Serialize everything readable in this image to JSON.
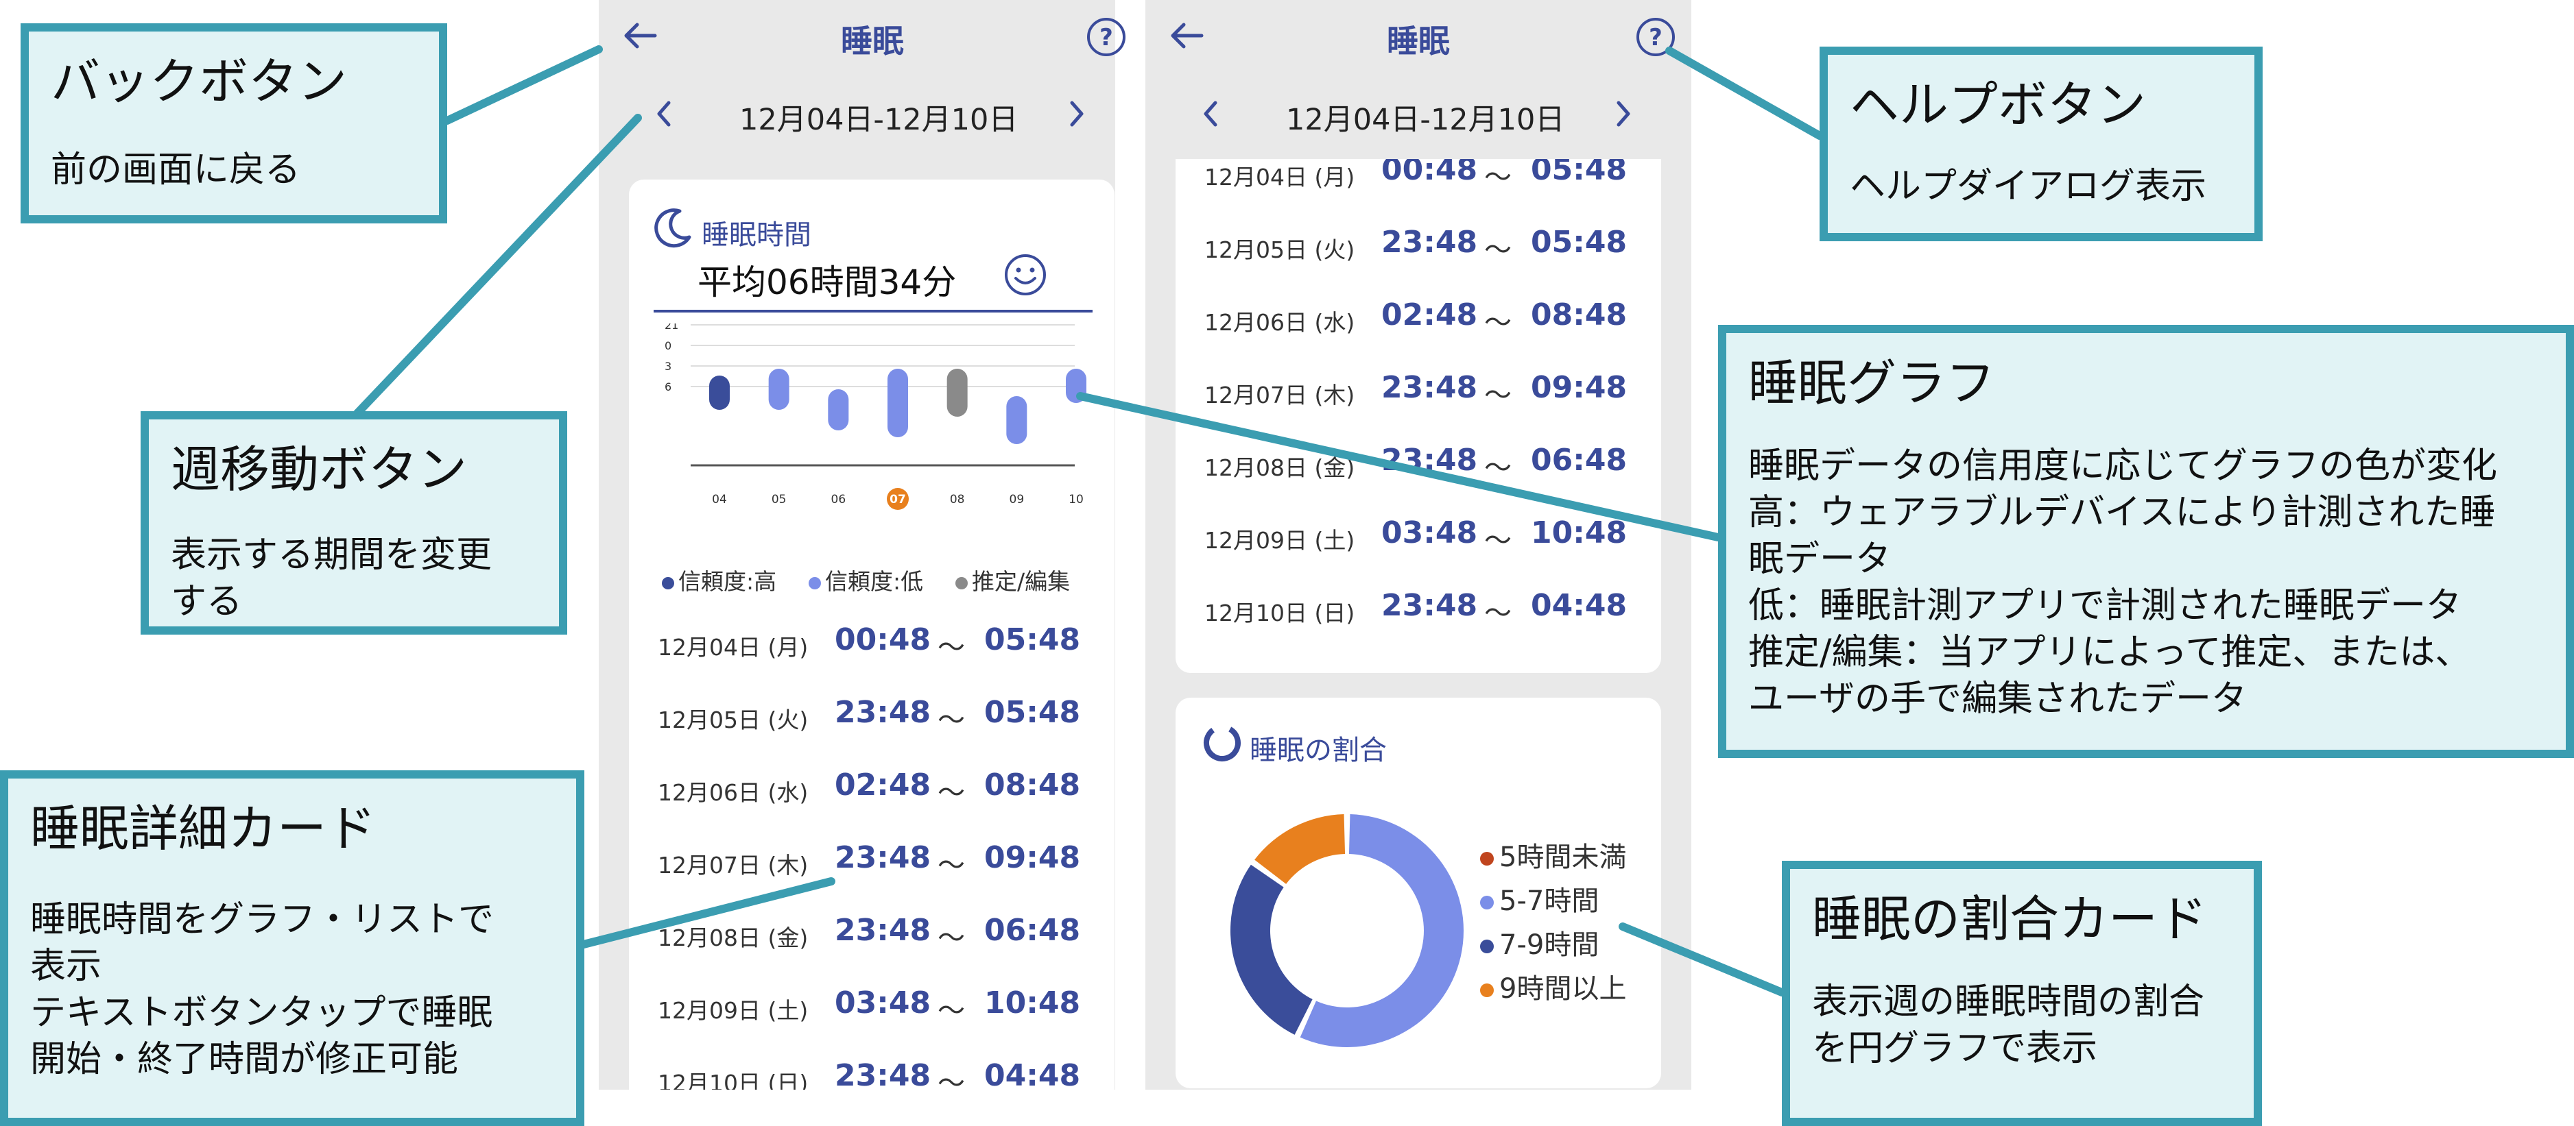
{
  "screen": {
    "title": "睡眠",
    "week_range": "12月04日-12月10日"
  },
  "sleep_card": {
    "title": "睡眠時間",
    "average": "平均06時間34分",
    "y_ticks": [
      "21",
      "0",
      "3",
      "6"
    ],
    "x_ticks": [
      "04",
      "05",
      "06",
      "07",
      "08",
      "09",
      "10"
    ],
    "highlight_tick": "07",
    "legend": {
      "high": "信頼度:高",
      "low": "信頼度:低",
      "estimated": "推定/編集"
    },
    "colors": {
      "high": "#3a4d9a",
      "low": "#7b8ee8",
      "estimated": "#8a8a8a",
      "highlight": "#e8801e"
    }
  },
  "chart_data": {
    "type": "bar",
    "categories": [
      "04",
      "05",
      "06",
      "07",
      "08",
      "09",
      "10"
    ],
    "series": [
      {
        "name": "",
        "start": [
          0.8,
          -0.2,
          2.8,
          -0.2,
          -0.2,
          3.8,
          -0.2
        ],
        "end": [
          5.8,
          5.8,
          8.8,
          9.8,
          6.8,
          10.8,
          4.8
        ],
        "confidence": [
          "high",
          "low",
          "low",
          "low",
          "estimated",
          "low",
          "low"
        ]
      }
    ],
    "ylim": [
      -3,
      12
    ],
    "y_tick_values": [
      -3,
      0,
      3,
      6
    ]
  },
  "records": [
    {
      "date": "12月04日 (月)",
      "start": "00:48",
      "sep": "～",
      "end": "05:48"
    },
    {
      "date": "12月05日 (火)",
      "start": "23:48",
      "sep": "～",
      "end": "05:48"
    },
    {
      "date": "12月06日 (水)",
      "start": "02:48",
      "sep": "～",
      "end": "08:48"
    },
    {
      "date": "12月07日 (木)",
      "start": "23:48",
      "sep": "～",
      "end": "09:48"
    },
    {
      "date": "12月08日 (金)",
      "start": "23:48",
      "sep": "～",
      "end": "06:48"
    },
    {
      "date": "12月09日 (土)",
      "start": "03:48",
      "sep": "～",
      "end": "10:48"
    },
    {
      "date": "12月10日 (日)",
      "start": "23:48",
      "sep": "～",
      "end": "04:48"
    }
  ],
  "ratio_card": {
    "title": "睡眠の割合",
    "legend": [
      "5時間未満",
      "5-7時間",
      "7-9時間",
      "9時間以上"
    ],
    "colors": [
      "#c0451e",
      "#7b8ee8",
      "#3a4d9a",
      "#e8801e"
    ],
    "values": [
      0,
      57,
      28,
      15
    ]
  },
  "callouts": {
    "back": {
      "title": "バックボタン",
      "body": "前の画面に戻る"
    },
    "week": {
      "title": "週移動ボタン",
      "body": "表示する期間を変更\nする"
    },
    "detail": {
      "title": "睡眠詳細カード",
      "body": "睡眠時間をグラフ・リストで\n表示\nテキストボタンタップで睡眠\n開始・終了時間が修正可能"
    },
    "help": {
      "title": "ヘルプボタン",
      "body": "ヘルプダイアログ表示"
    },
    "graph": {
      "title": "睡眠グラフ",
      "body": "睡眠データの信用度に応じてグラフの色が変化\n高：ウェアラブルデバイスにより計測された睡\n眠データ\n低：睡眠計測アプリで計測された睡眠データ\n推定/編集：当アプリによって推定、または、\nユーザの手で編集されたデータ"
    },
    "ratio": {
      "title": "睡眠の割合カード",
      "body": "表示週の睡眠時間の割合\nを円グラフで表示"
    }
  }
}
